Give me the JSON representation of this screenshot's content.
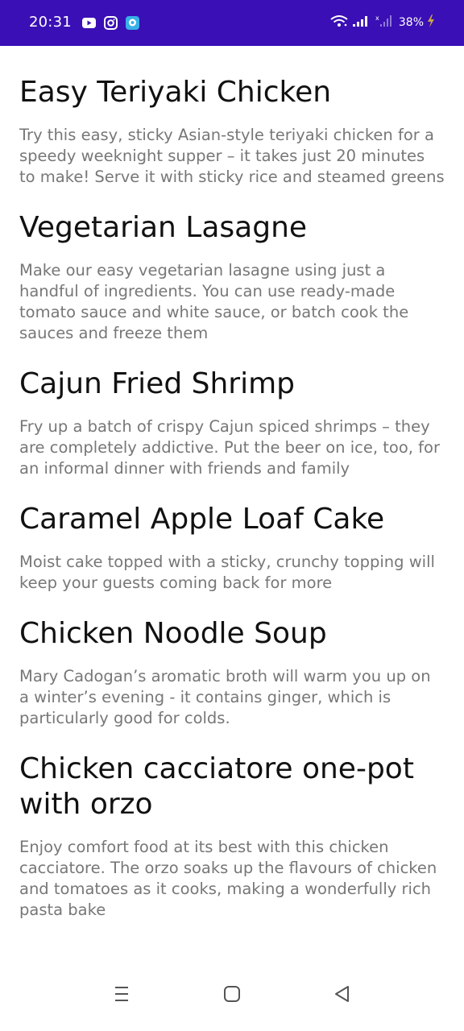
{
  "status_bar": {
    "time": "20:31",
    "battery": "38%",
    "icons_left": [
      "youtube-icon",
      "instagram-icon",
      "chat-app-icon"
    ],
    "icons_right": [
      "wifi-icon",
      "signal-icon",
      "no-sim-signal-icon",
      "battery-charging-icon"
    ],
    "background_color": "#3a0fb5"
  },
  "recipes": [
    {
      "title": "Easy Teriyaki Chicken",
      "description": "Try this easy, sticky Asian-style teriyaki chicken for a speedy weeknight supper – it takes just 20 minutes to make! Serve it with sticky rice and steamed greens"
    },
    {
      "title": "Vegetarian Lasagne",
      "description": "Make our easy vegetarian lasagne using just a handful of ingredients. You can use ready-made tomato sauce and white sauce, or batch cook the sauces and freeze them"
    },
    {
      "title": "Cajun Fried Shrimp",
      "description": "Fry up a batch of crispy Cajun spiced shrimps – they are completely addictive. Put the beer on ice, too, for an informal dinner with friends and family"
    },
    {
      "title": "Caramel Apple Loaf Cake",
      "description": "Moist cake topped with a sticky, crunchy topping will keep your guests coming back for more"
    },
    {
      "title": "Chicken Noodle Soup",
      "description": "Mary Cadogan’s aromatic broth will warm you up on a winter’s evening - it contains ginger, which is particularly good for colds."
    },
    {
      "title": "Chicken cacciatore one-pot with orzo",
      "description": "Enjoy comfort food at its best with this chicken cacciatore. The orzo soaks up the flavours of chicken and tomatoes as it cooks, making a wonderfully rich pasta bake"
    }
  ],
  "nav_bar": {
    "buttons": [
      "menu-icon",
      "home-icon",
      "back-icon"
    ]
  }
}
